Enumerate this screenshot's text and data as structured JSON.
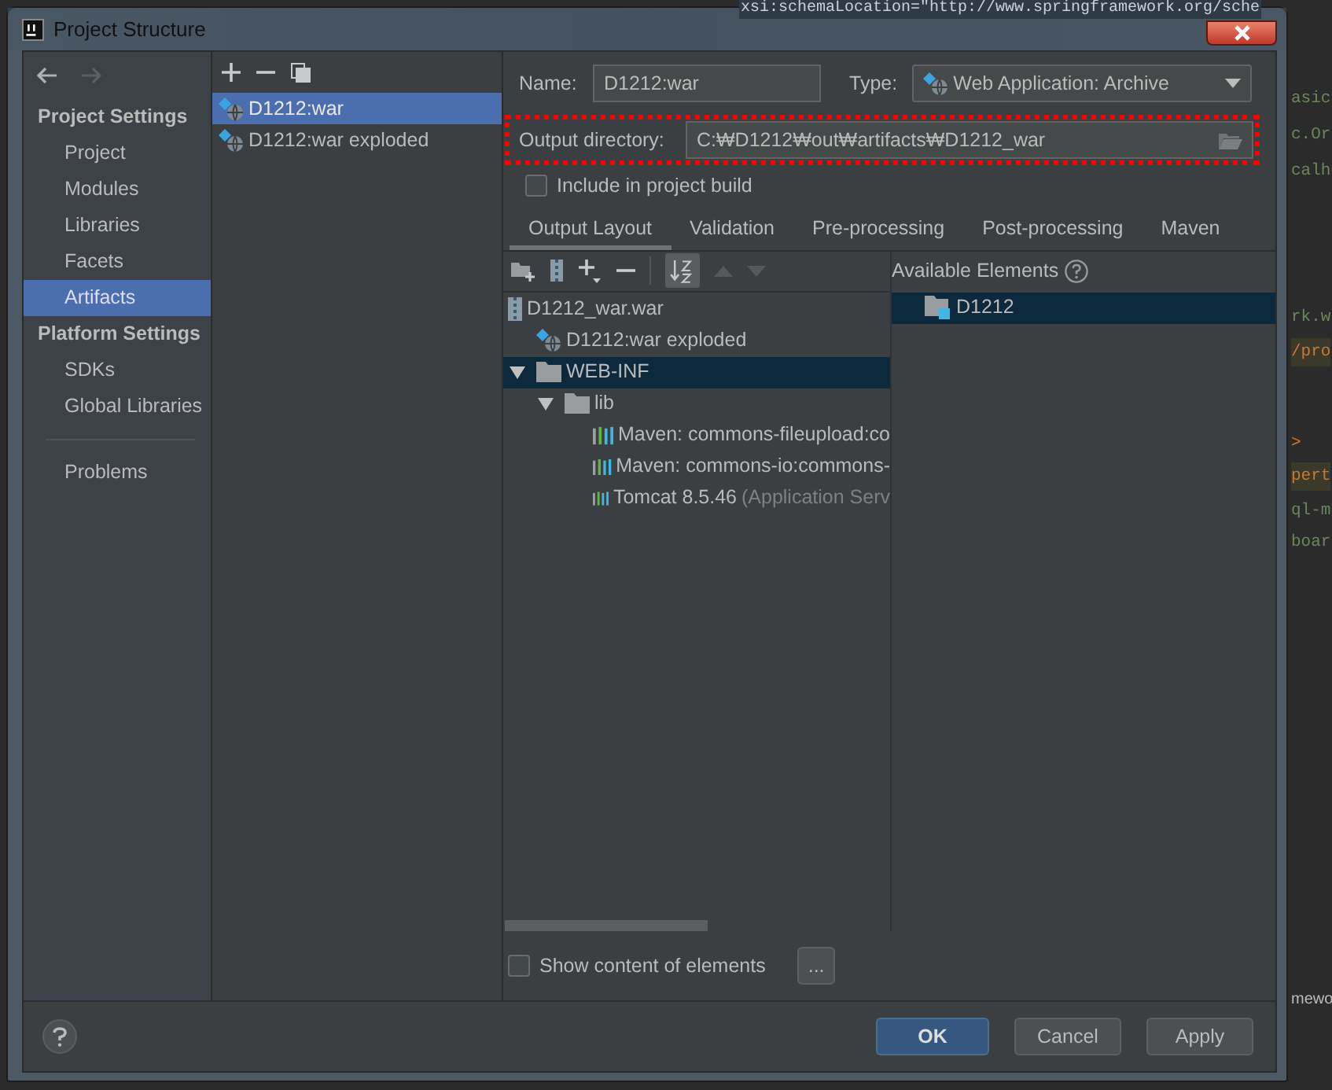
{
  "background_editor": {
    "top_line": "xsi:schemaLocation=\"http://www.springframework.org/sche",
    "lines": [
      {
        "text": "asic",
        "kind": "value",
        "highlighted": false
      },
      {
        "text": "c.Or",
        "kind": "value",
        "highlighted": false
      },
      {
        "text": "calh",
        "kind": "value",
        "highlighted": false
      },
      {
        "text": "rk.w",
        "kind": "value",
        "highlighted": false
      },
      {
        "text": "/pro",
        "kind": "tag",
        "highlighted": true
      },
      {
        "text": ">",
        "kind": "tag",
        "highlighted": false
      },
      {
        "text": "pert",
        "kind": "tag",
        "highlighted": true
      },
      {
        "text": "ql-m",
        "kind": "value",
        "highlighted": false
      },
      {
        "text": "boar",
        "kind": "value",
        "highlighted": false
      },
      {
        "text": "mewo",
        "kind": "plain",
        "highlighted": false
      }
    ]
  },
  "window": {
    "title": "Project Structure"
  },
  "sidebar": {
    "sections": [
      {
        "heading": "Project Settings",
        "items": [
          {
            "label": "Project",
            "selected": false
          },
          {
            "label": "Modules",
            "selected": false
          },
          {
            "label": "Libraries",
            "selected": false
          },
          {
            "label": "Facets",
            "selected": false
          },
          {
            "label": "Artifacts",
            "selected": true
          }
        ]
      },
      {
        "heading": "Platform Settings",
        "items": [
          {
            "label": "SDKs",
            "selected": false
          },
          {
            "label": "Global Libraries",
            "selected": false
          }
        ]
      }
    ],
    "footer_items": [
      {
        "label": "Problems",
        "selected": false
      }
    ]
  },
  "artifacts": [
    {
      "label": "D1212:war",
      "selected": true
    },
    {
      "label": "D1212:war exploded",
      "selected": false
    }
  ],
  "name": {
    "label": "Name:",
    "value": "D1212:war"
  },
  "type": {
    "label": "Type:",
    "value": "Web Application: Archive"
  },
  "output_directory": {
    "label": "Output directory:",
    "value": "C:₩D1212₩out₩artifacts₩D1212_war",
    "highlighted": true
  },
  "include_in_build": {
    "label": "Include in project build",
    "checked": false
  },
  "tabs": [
    {
      "label": "Output Layout",
      "selected": true
    },
    {
      "label": "Validation",
      "selected": false
    },
    {
      "label": "Pre-processing",
      "selected": false
    },
    {
      "label": "Post-processing",
      "selected": false
    },
    {
      "label": "Maven",
      "selected": false
    }
  ],
  "layout_tree": [
    {
      "label": "D1212_war.war",
      "kind": "archive",
      "selected": false,
      "children": [
        {
          "label": "D1212:war exploded",
          "kind": "artifact",
          "selected": false
        },
        {
          "label": "WEB-INF",
          "kind": "folder",
          "selected": true,
          "expanded": true,
          "children": [
            {
              "label": "lib",
              "kind": "folder",
              "selected": false,
              "expanded": true,
              "children": [
                {
                  "label": "Maven: commons-fileupload:co",
                  "kind": "library",
                  "selected": false
                },
                {
                  "label": "Maven: commons-io:commons-",
                  "kind": "library",
                  "selected": false
                },
                {
                  "label": "Tomcat 8.5.46",
                  "note": "(Application Serv",
                  "kind": "library",
                  "selected": false
                }
              ]
            }
          ]
        }
      ]
    }
  ],
  "available_elements": {
    "title": "Available Elements",
    "items": [
      {
        "label": "D1212",
        "kind": "module",
        "selected": true
      }
    ]
  },
  "show_content": {
    "label": "Show content of elements",
    "checked": false
  },
  "more_button": "...",
  "buttons": [
    {
      "label": "OK",
      "kind": "primary"
    },
    {
      "label": "Cancel",
      "kind": "default"
    },
    {
      "label": "Apply",
      "kind": "default"
    }
  ]
}
